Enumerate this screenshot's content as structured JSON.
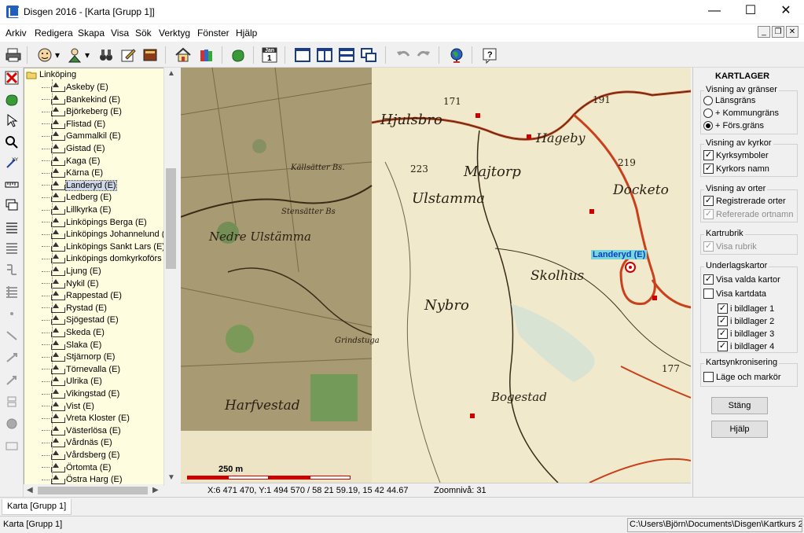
{
  "window": {
    "title": "Disgen 2016 - [Karta [Grupp 1]]",
    "minimize": "—",
    "maximize": "☐",
    "close": "✕"
  },
  "menu": [
    "Arkiv",
    "Redigera",
    "Skapa",
    "Visa",
    "Sök",
    "Verktyg",
    "Fönster",
    "Hjälp"
  ],
  "toolbar": {
    "calendar_label": "Jan",
    "calendar_day": "1"
  },
  "tree": {
    "root": "Linköping",
    "items": [
      "Askeby (E)",
      "Bankekind (E)",
      "Björkeberg (E)",
      "Flistad (E)",
      "Gammalkil (E)",
      "Gistad (E)",
      "Kaga (E)",
      "Kärna (E)",
      "Landeryd (E)",
      "Ledberg (E)",
      "Lillkyrka (E)",
      "Linköpings Berga (E)",
      "Linköpings Johannelund (E)",
      "Linköpings Sankt Lars (E)",
      "Linköpings domkyrkoförs (E)",
      "Ljung (E)",
      "Nykil (E)",
      "Rappestad (E)",
      "Rystad (E)",
      "Sjögestad (E)",
      "Skeda (E)",
      "Slaka (E)",
      "Stjärnorp (E)",
      "Törnevalla (E)",
      "Ulrika (E)",
      "Vikingstad (E)",
      "Vist (E)",
      "Vreta Kloster (E)",
      "Västerlösa (E)",
      "Vårdnäs (E)",
      "Vårdsberg (E)",
      "Örtomta (E)",
      "Östra Harg (E)"
    ],
    "selected": "Landeryd (E)"
  },
  "map": {
    "labels": {
      "hjulsbro": "Hjulsbro",
      "hageby": "Hageby",
      "majtorp": "Majtorp",
      "ulstamma": "Ulstamma",
      "nedre_ulstamma": "Nedre Ulstämma",
      "skolhus": "Skolhus",
      "nybro": "Nybro",
      "harfvestad": "Harfvestad",
      "dockstorp": "Docketo",
      "bogestad": "Bogestad",
      "grindstugan": "Grindstuga",
      "kallsatter": "Källsätter Bs.",
      "stensatter": "Stensätter Bs",
      "n171": "171",
      "n191": "191",
      "n219": "219",
      "n223": "223",
      "n177": "177"
    },
    "highlight": "Landeryd (E)",
    "scale": "250 m"
  },
  "map_status": {
    "coords": "X:6 471 470, Y:1 494 570 / 58 21 59.19, 15 42 44.67",
    "zoom": "Zoomnivå: 31"
  },
  "panel": {
    "title": "KARTLAGER",
    "borders": {
      "title": "Visning av gränser",
      "options": [
        "Länsgräns",
        "+ Kommungräns",
        "+ Förs.gräns"
      ],
      "selected_index": 2
    },
    "churches": {
      "title": "Visning av kyrkor",
      "options": [
        "Kyrksymboler",
        "Kyrkors namn"
      ]
    },
    "places": {
      "title": "Visning av orter",
      "options": [
        "Registrerade orter",
        "Refererade ortnamn"
      ]
    },
    "heading": {
      "title": "Kartrubrik",
      "options": [
        "Visa rubrik"
      ]
    },
    "base_maps": {
      "title": "Underlagskartor",
      "options": [
        "Visa valda kartor",
        "Visa kartdata"
      ],
      "layers": [
        "i bildlager 1",
        "i bildlager 2",
        "i bildlager 3",
        "i bildlager 4"
      ]
    },
    "sync": {
      "title": "Kartsynkronisering",
      "options": [
        "Läge och markör"
      ]
    },
    "close_button": "Stäng",
    "help_button": "Hjälp"
  },
  "tabs": [
    "Karta [Grupp 1]"
  ],
  "status": {
    "left": "Karta [Grupp 1]",
    "right": "C:\\Users\\Björn\\Documents\\Disgen\\Kartkurs 2"
  },
  "colors": {
    "tree_bg": "#fffde0",
    "highlight_tag": "#7ad7d9",
    "road": "#c8401c"
  }
}
